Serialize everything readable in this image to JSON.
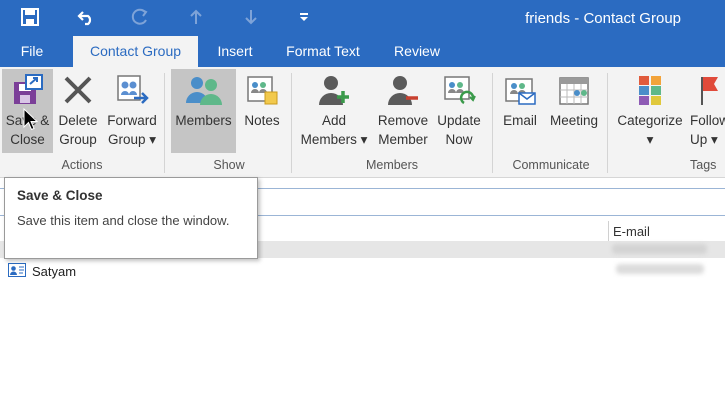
{
  "window": {
    "title": "friends - Contact Group"
  },
  "quick_access": [
    "save-icon",
    "undo-icon",
    "redo-icon",
    "up-arrow-icon",
    "down-arrow-icon",
    "customize-toolbar-icon"
  ],
  "tabs": [
    {
      "label": "File",
      "active": false
    },
    {
      "label": "Contact Group",
      "active": true
    },
    {
      "label": "Insert",
      "active": false
    },
    {
      "label": "Format Text",
      "active": false
    },
    {
      "label": "Review",
      "active": false
    }
  ],
  "ribbon": {
    "buttons": {
      "save_close": {
        "line1": "Save &",
        "line2": "Close"
      },
      "delete_group": {
        "line1": "Delete",
        "line2": "Group"
      },
      "forward_group": {
        "line1": "Forward",
        "line2": "Group ▾"
      },
      "members": {
        "line1": "Members"
      },
      "notes": {
        "line1": "Notes"
      },
      "add_members": {
        "line1": "Add",
        "line2": "Members ▾"
      },
      "remove_member": {
        "line1": "Remove",
        "line2": "Member"
      },
      "update_now": {
        "line1": "Update",
        "line2": "Now"
      },
      "email": {
        "line1": "Email"
      },
      "meeting": {
        "line1": "Meeting"
      },
      "categorize": {
        "line1": "Categorize",
        "line2": "▾"
      },
      "follow_up": {
        "line1": "Follow",
        "line2": "Up ▾"
      }
    },
    "groups": {
      "actions": "Actions",
      "show": "Show",
      "members": "Members",
      "communicate": "Communicate",
      "tags": "Tags"
    }
  },
  "tooltip": {
    "title": "Save & Close",
    "body": "Save this item and close the window."
  },
  "list": {
    "columns": {
      "email": "E-mail"
    },
    "rows": [
      {
        "name": "Satyam"
      }
    ]
  },
  "colors": {
    "brand": "#2b6bc1",
    "ribbon_bg": "#f3f3f3",
    "selected_button": "#c5c5c5"
  }
}
